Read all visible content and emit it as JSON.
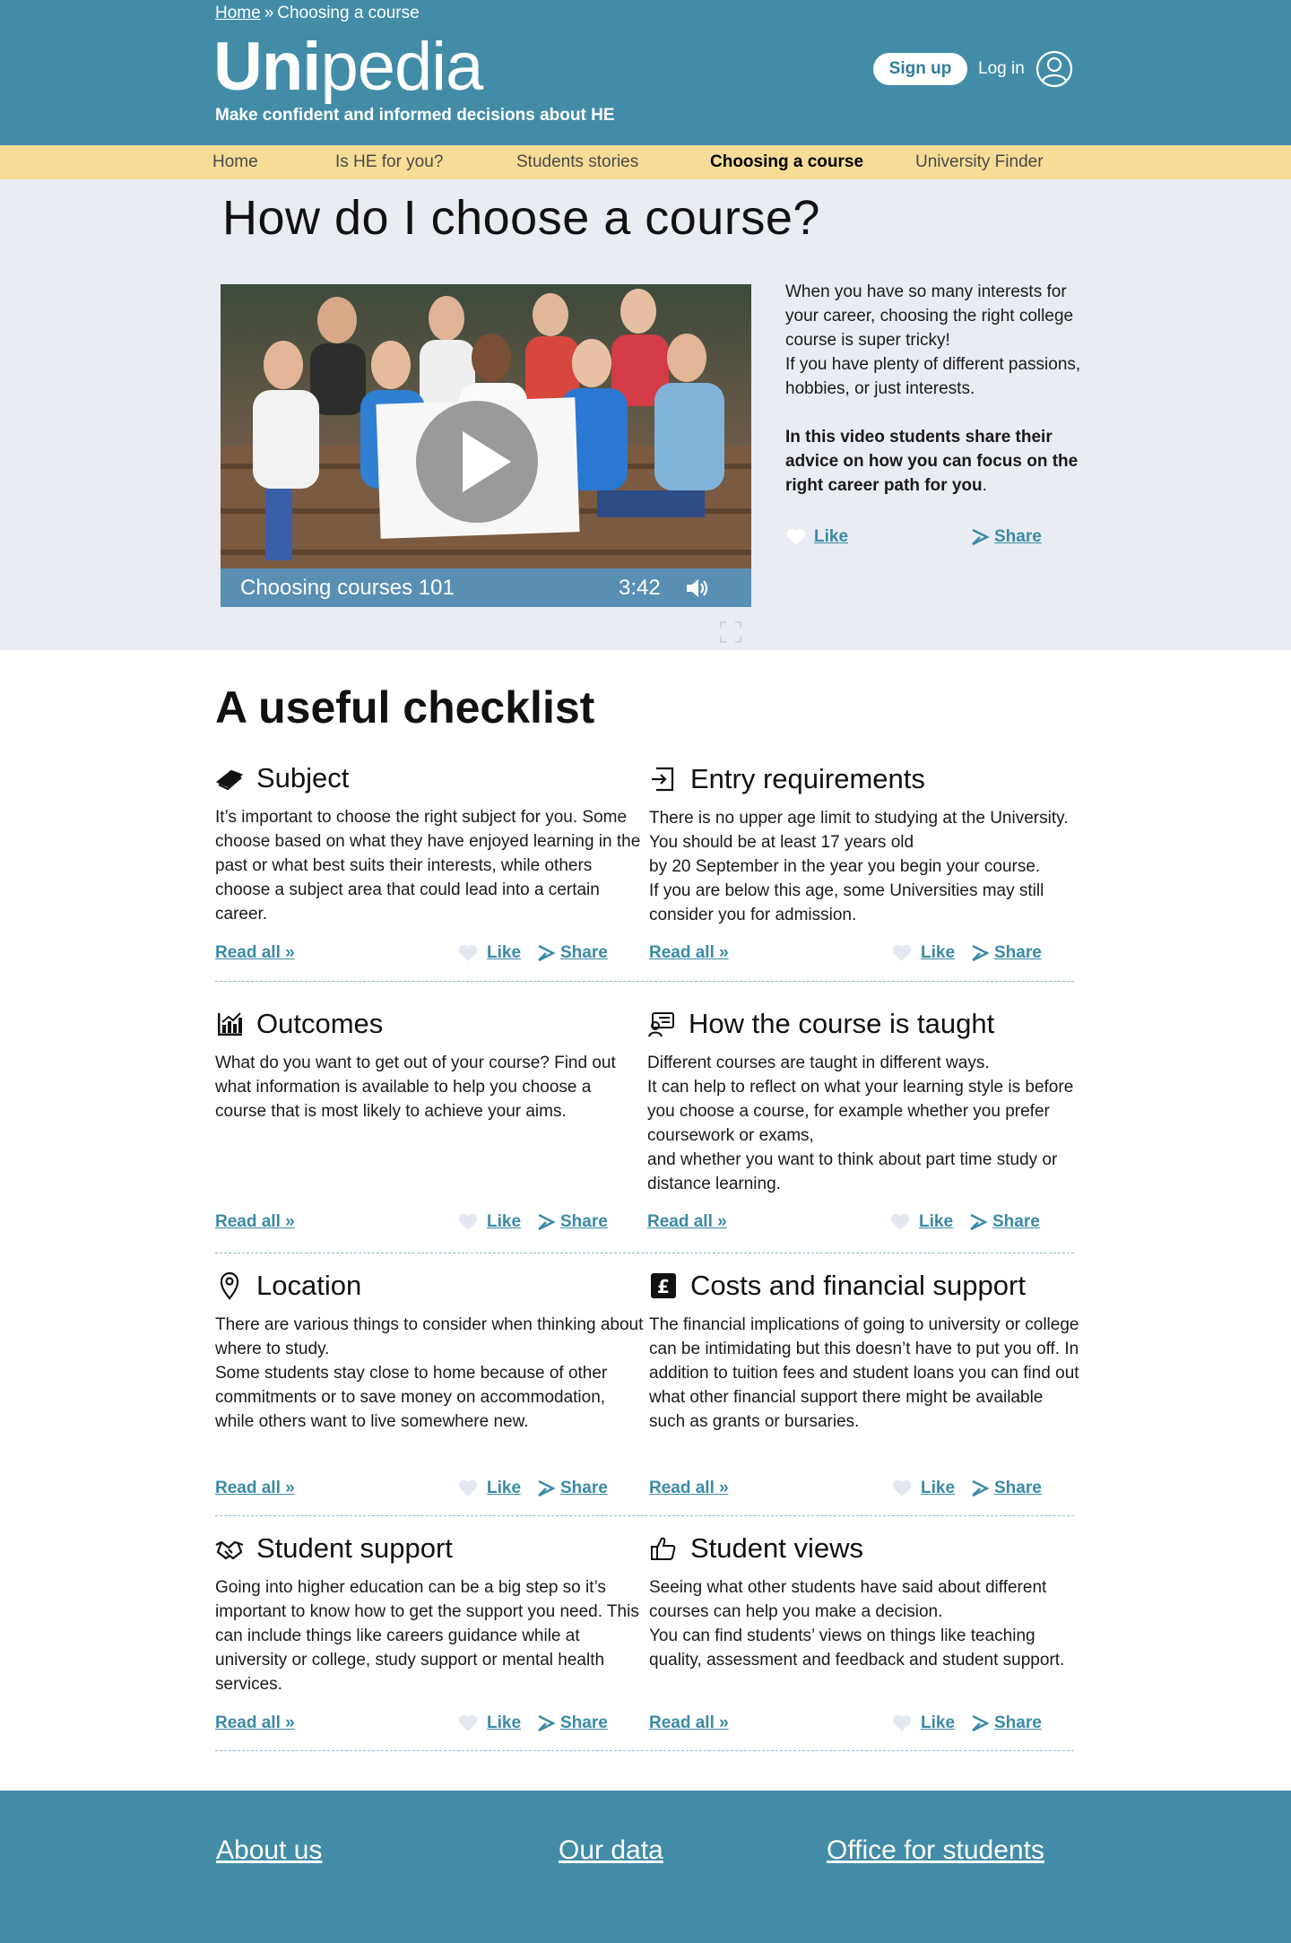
{
  "breadcrumb": {
    "home": "Home",
    "separator": "»",
    "current": "Choosing a course"
  },
  "brand": {
    "logo_bold": "Uni",
    "logo_light": "pedia",
    "tagline": "Make confident and informed decisions about HE"
  },
  "header": {
    "signup": "Sign up",
    "login": "Log in"
  },
  "nav": {
    "items": [
      {
        "label": "Home"
      },
      {
        "label": "Is HE for you?"
      },
      {
        "label": "Students stories"
      },
      {
        "label": "Choosing a course",
        "active": true
      },
      {
        "label": "University Finder"
      }
    ]
  },
  "hero": {
    "title": "How do I choose a course?",
    "video": {
      "title": "Choosing courses 101",
      "duration": "3:42"
    },
    "intro_1": "When you have so many interests for your career, choosing the right college course is super tricky!",
    "intro_2": "If you have plenty of different passions, hobbies, or just interests.",
    "intro_bold": "In this video students share their advice on how you can focus on the right career path for you",
    "intro_period": ".",
    "like": "Like",
    "share": "Share"
  },
  "checklist": {
    "title": "A useful checklist",
    "read_all": "Read all »",
    "like": "Like",
    "share": "Share",
    "cards": [
      {
        "icon": "book-icon",
        "title": "Subject",
        "paragraphs": [
          "It’s important to choose the right subject for you. Some choose based on what they have enjoyed learning in the past or what best suits their interests, while others choose a subject area that could lead into a certain career."
        ]
      },
      {
        "icon": "sign-in-icon",
        "title": "Entry requirements",
        "paragraphs": [
          "There is no upper age limit to studying at the University. You should be at least 17 years old",
          "by 20 September in the year you begin your course.",
          "If you are below this age, some Universities may still consider you for admission."
        ]
      },
      {
        "icon": "bar-chart-icon",
        "title": "Outcomes",
        "paragraphs": [
          "What do you want to get out of your course? Find out what information is available to help you choose a course that is most likely to achieve your aims."
        ]
      },
      {
        "icon": "presentation-icon",
        "title": "How the course is taught",
        "paragraphs": [
          "Different courses are taught in different ways.",
          "It can help to reflect on what your learning style is before you choose a course, for example whether you prefer coursework or exams,",
          "and whether you want to think about part time study or distance learning."
        ]
      },
      {
        "icon": "map-pin-icon",
        "title": "Location",
        "paragraphs": [
          "There are various things to consider when thinking about where to study.",
          "Some students stay close to home because of other commitments or to save money on accommodation, while others want to live somewhere new."
        ]
      },
      {
        "icon": "pound-icon",
        "title": "Costs and financial support",
        "paragraphs": [
          "The financial implications of going to university or college can be intimidating but this doesn’t have to put you off. In addition to tuition fees and student loans you can find out what other financial support there might be available such as grants or bursaries."
        ]
      },
      {
        "icon": "handshake-icon",
        "title": "Student support",
        "paragraphs": [
          "Going into higher education can be a big step so it’s important to know how to get the support you need. This can include things like careers guidance while at university or college, study support or mental health services."
        ]
      },
      {
        "icon": "thumbs-up-icon",
        "title": "Student views",
        "paragraphs": [
          "Seeing what other students have said about different courses can help you make a decision.",
          "You can find students’ views on things like teaching quality, assessment and feedback and student support."
        ]
      }
    ]
  },
  "footer": {
    "links": [
      "About us",
      "Our data",
      "Office for students"
    ]
  },
  "colors": {
    "header": "#428ca8",
    "nav": "#f6dc96",
    "hero_bg": "#e9ecf2",
    "link": "#3a8aa6",
    "video_bar": "#5a8fb4"
  }
}
